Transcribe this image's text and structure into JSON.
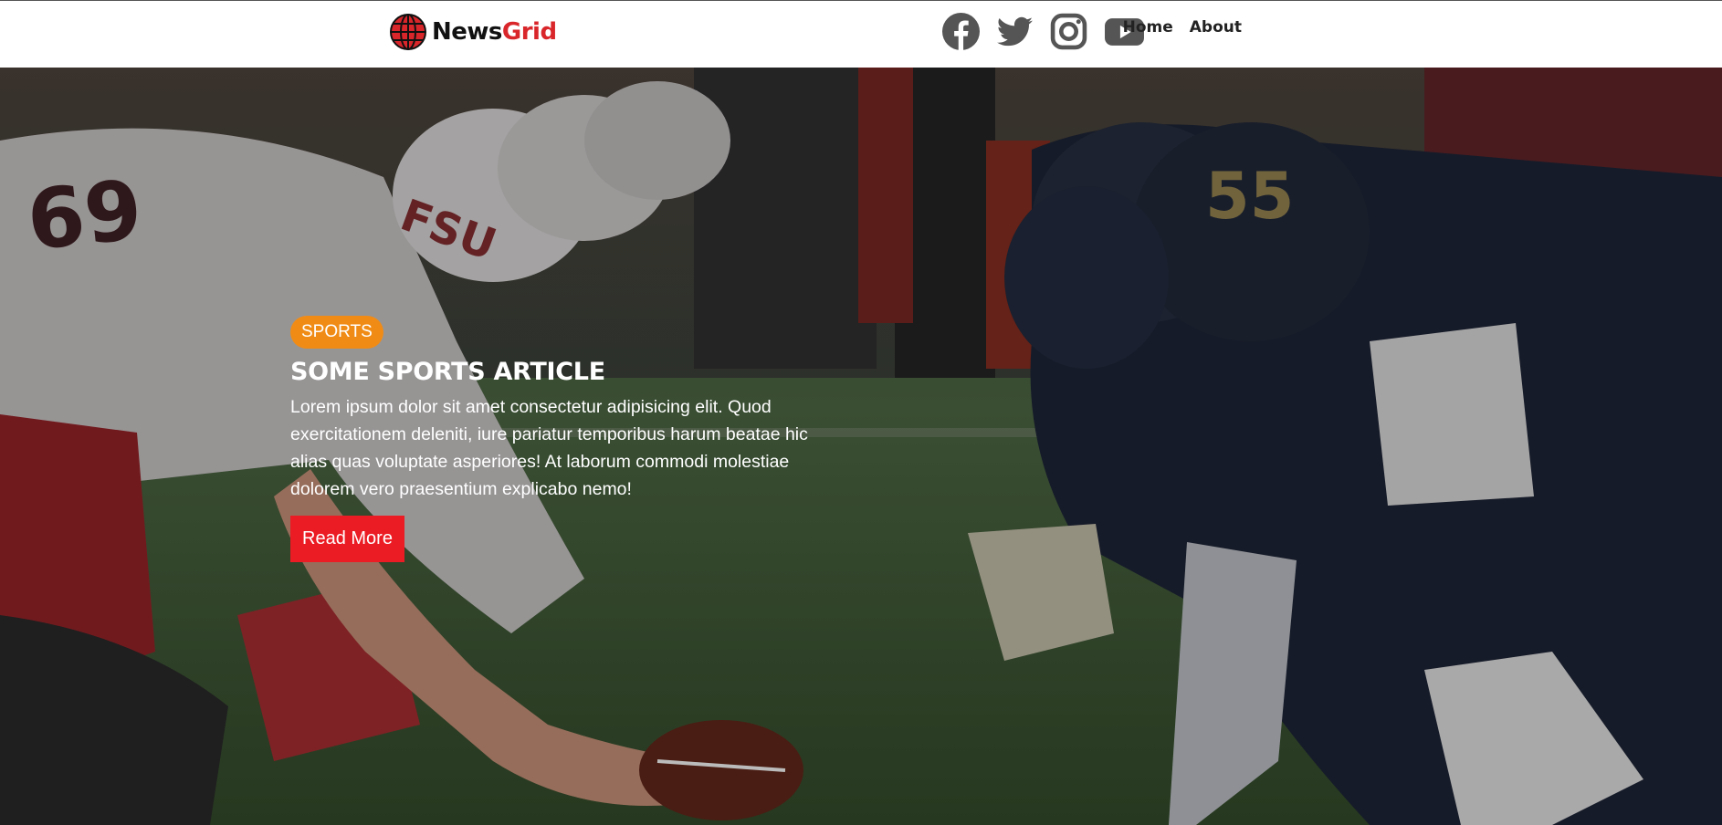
{
  "brand": {
    "name_part1": "News",
    "name_part2": "Grid",
    "logo_icon": "globe-icon",
    "accent_color": "#d9262b"
  },
  "social": [
    {
      "icon": "facebook-icon"
    },
    {
      "icon": "twitter-icon"
    },
    {
      "icon": "instagram-icon"
    },
    {
      "icon": "youtube-icon"
    }
  ],
  "nav": {
    "links": [
      "Home",
      "About"
    ]
  },
  "hero": {
    "badge": "SPORTS",
    "badge_color": "#f08c16",
    "title": "SOME SPORTS ARTICLE",
    "excerpt": "Lorem ipsum dolor sit amet consectetur adipisicing elit. Quod exercitationem deleniti, iure pariatur temporibus harum beatae hic alias quas voluptate asperiores! At laborum commodi molestiae dolorem vero praesentium explicabo nemo!",
    "button_label": "Read More",
    "button_color": "#ec1c24"
  }
}
